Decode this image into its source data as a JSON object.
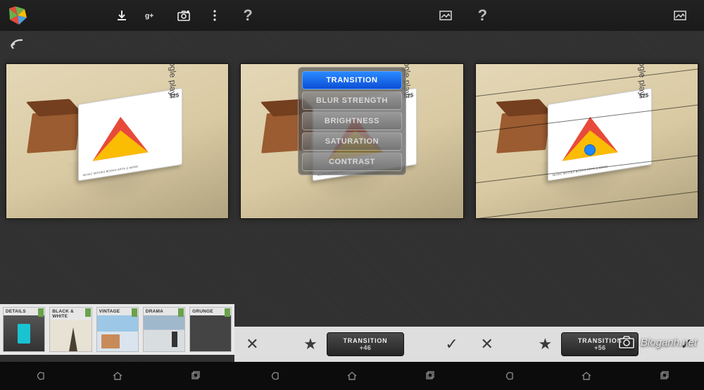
{
  "watermark": "Bloganh.net",
  "card": {
    "brand": "Google play",
    "price": "$25",
    "strip": "MUSIC MOVIES BOOKS APPS & MORE"
  },
  "screen1": {
    "filters": [
      {
        "label": "DETAILS"
      },
      {
        "label": "BLACK & WHITE"
      },
      {
        "label": "VINTAGE"
      },
      {
        "label": "DRAMA"
      },
      {
        "label": "GRUNGE"
      }
    ]
  },
  "screen2": {
    "menu": [
      {
        "label": "TRANSITION",
        "active": true
      },
      {
        "label": "BLUR STRENGTH",
        "active": false
      },
      {
        "label": "BRIGHTNESS",
        "active": false
      },
      {
        "label": "SATURATION",
        "active": false
      },
      {
        "label": "CONTRAST",
        "active": false
      }
    ],
    "status": {
      "label": "TRANSITION",
      "value": "+46"
    }
  },
  "screen3": {
    "status": {
      "label": "TRANSITION",
      "value": "+56"
    }
  }
}
